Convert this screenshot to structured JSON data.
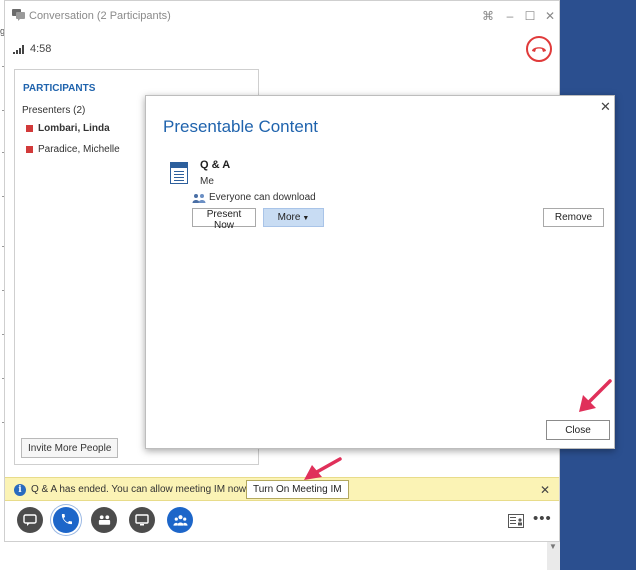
{
  "window": {
    "title": "Conversation (2 Participants)",
    "call_timer": "4:58"
  },
  "participants": {
    "header": "PARTICIPANTS",
    "group_label": "Presenters (2)",
    "list": [
      {
        "name": "Lombari, Linda",
        "bold": true
      },
      {
        "name": "Paradice, Michelle",
        "bold": false
      }
    ],
    "invite_button": "Invite More People"
  },
  "notice": {
    "text": "Q & A has ended. You can allow meeting IM now.",
    "button": "Turn On Meeting IM"
  },
  "dialog": {
    "title": "Presentable Content",
    "item": {
      "name": "Q & A",
      "owner": "Me",
      "permission": "Everyone can download"
    },
    "buttons": {
      "present_now": "Present Now",
      "more": "More",
      "remove": "Remove",
      "close": "Close"
    }
  },
  "colors": {
    "accent_blue": "#1f63ad",
    "hangup_red": "#e03a3a",
    "presence_busy": "#d23a3a",
    "notice_bg": "#fbf3b5",
    "annotation_arrow": "#e0305a",
    "background_blue": "#2b4f8f"
  },
  "icons": {
    "app": "conversation-icon",
    "signal": "signal-strength-icon",
    "hangup": "hang-up-icon",
    "info": "info-icon",
    "toolbar": [
      "im-icon",
      "phone-icon",
      "video-icon",
      "present-icon",
      "participants-icon"
    ],
    "roster": "participant-roster-icon",
    "more": "more-options-icon"
  }
}
